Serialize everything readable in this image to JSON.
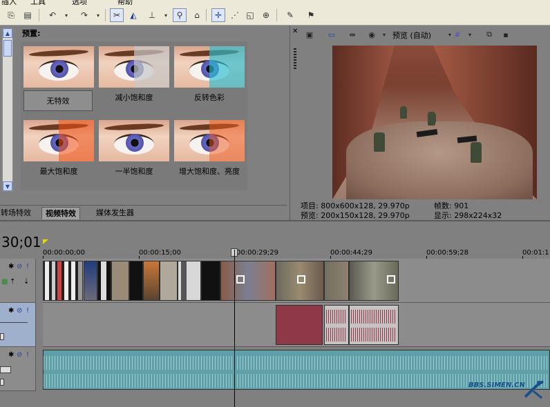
{
  "menu": [
    "插入",
    "工具",
    "选项",
    "帮助"
  ],
  "toolbar": {
    "icons": [
      "cursor-icon",
      "paste-icon",
      "undo-icon",
      "redo-icon",
      "snap-icon",
      "envelope-icon",
      "marker-icon",
      "lock-icon",
      "ripple-icon",
      "edit-tool-icon",
      "envelope-tool-icon",
      "selection-tool-icon",
      "zoom-tool-icon",
      "erase-icon",
      "split-icon"
    ]
  },
  "effects": {
    "title": "预置:",
    "presets": [
      {
        "label": "无特效",
        "selected": true,
        "tint": "none"
      },
      {
        "label": "减小饱和度",
        "selected": false,
        "tint": "gray"
      },
      {
        "label": "反转色彩",
        "selected": false,
        "tint": "cyan"
      },
      {
        "label": "最大饱和度",
        "selected": false,
        "tint": "orange"
      },
      {
        "label": "一半饱和度",
        "selected": false,
        "tint": "none"
      },
      {
        "label": "增大饱和度、亮度",
        "selected": false,
        "tint": "orange"
      }
    ]
  },
  "tabs": [
    {
      "label": "转场特效",
      "active": false
    },
    {
      "label": "视频特效",
      "active": true
    },
    {
      "label": "媒体发生器",
      "active": false
    }
  ],
  "preview": {
    "quality_label": "预览 (自动)",
    "project_line": "项目: 800x600x128, 29.970p",
    "preview_line": "预览: 200x150x128, 29.970p",
    "frames_line": "帧数: 901",
    "display_line": "显示: 298x224x32"
  },
  "timeline": {
    "timecode": "30;01",
    "ruler": [
      "00:00:00;00",
      "00:00:15;00",
      "00:00:29;29",
      "00:00:44;29",
      "00:00:59;28",
      "00:01:1"
    ]
  },
  "watermark": "BBS.SIMEN.CN",
  "colors": {
    "audio_clip": "#8f3848",
    "music_track": "#5fa0a8",
    "selected_header": "#9fb0cc"
  }
}
